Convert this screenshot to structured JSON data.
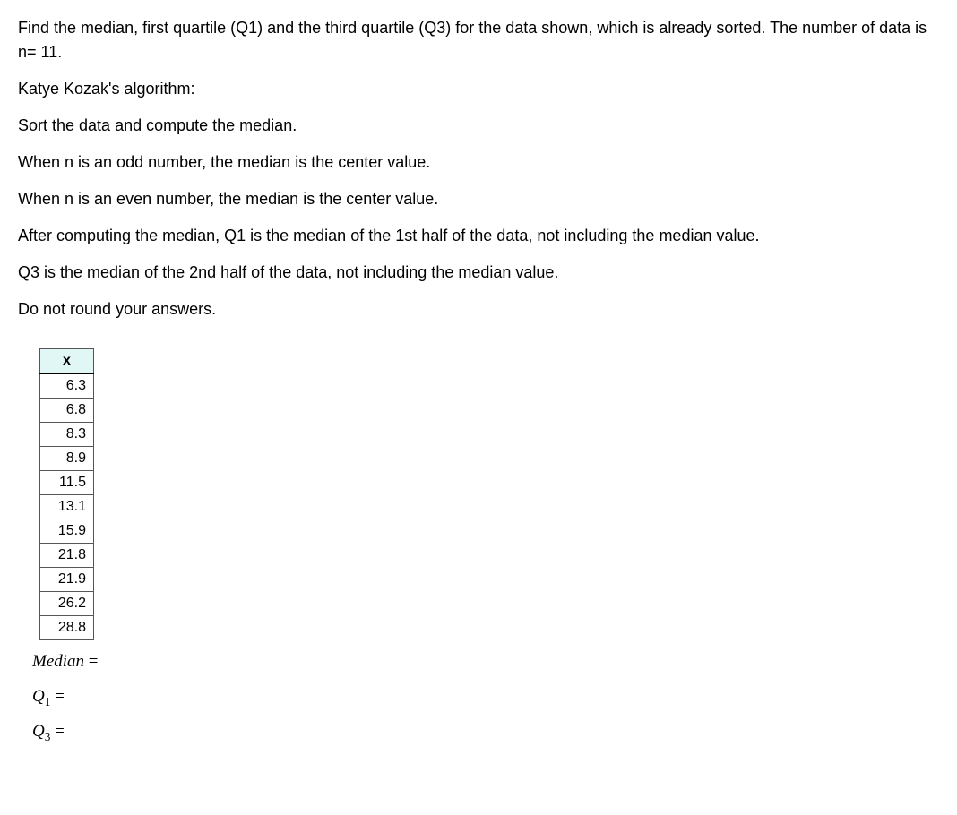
{
  "instructions": {
    "line1": "Find the median, first quartile (Q1) and the third quartile (Q3) for the data shown, which is already sorted. The number of data is n= 11.",
    "line2": "Katye Kozak's algorithm:",
    "line3": "Sort the data and compute the median.",
    "line4": "When n is an odd number, the median is the center value.",
    "line5": "When n is an even number, the median is the center value.",
    "line6": "After computing the median, Q1 is the median of the 1st half of the data, not including the median value.",
    "line7": "Q3 is the median of the 2nd half of the data, not including the median value.",
    "line8": "Do not round your answers."
  },
  "table": {
    "header": "x",
    "values": [
      "6.3",
      "6.8",
      "8.3",
      "8.9",
      "11.5",
      "13.1",
      "15.9",
      "21.8",
      "21.9",
      "26.2",
      "28.8"
    ]
  },
  "answers": {
    "median_label": "Median",
    "q1_label_prefix": "Q",
    "q1_label_index": "1",
    "q3_label_prefix": "Q",
    "q3_label_index": "3",
    "equals": "=",
    "median_value": "",
    "q1_value": "",
    "q3_value": ""
  }
}
